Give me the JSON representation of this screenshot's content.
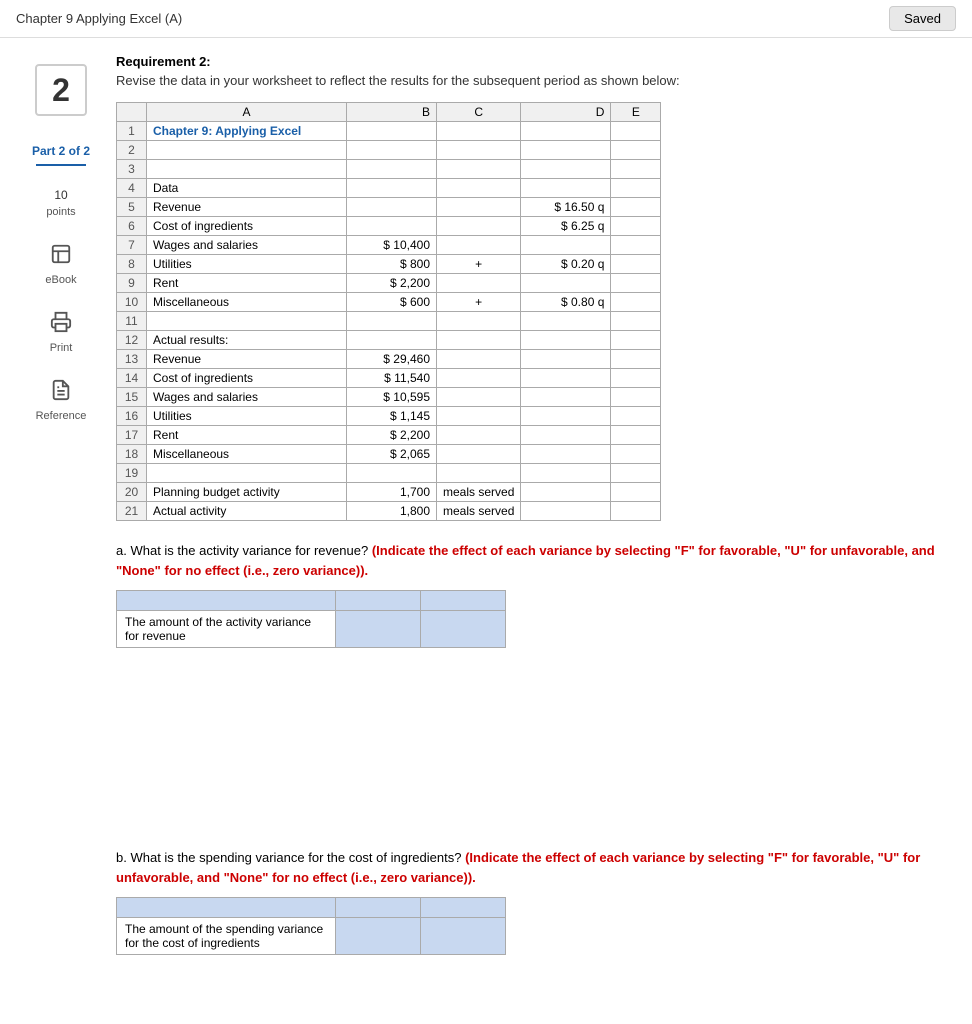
{
  "topBar": {
    "title": "Chapter 9 Applying Excel (A)",
    "savedLabel": "Saved"
  },
  "sidebar": {
    "stepNumber": "2",
    "partLabel": "Part 2 of 2",
    "points": "10",
    "pointsLabel": "points",
    "ebookLabel": "eBook",
    "printLabel": "Print",
    "referenceLabel": "Reference"
  },
  "requirement": {
    "title": "Requirement 2:",
    "text": "Revise the data in your worksheet to reflect the results for the subsequent period as shown below:"
  },
  "spreadsheet": {
    "headers": [
      "",
      "A",
      "B",
      "C",
      "D",
      "E"
    ],
    "rows": [
      {
        "num": "1",
        "a": "Chapter 9: Applying Excel",
        "b": "",
        "c": "",
        "d": "",
        "e": "",
        "aBlue": true
      },
      {
        "num": "2",
        "a": "",
        "b": "",
        "c": "",
        "d": "",
        "e": ""
      },
      {
        "num": "3",
        "a": "",
        "b": "",
        "c": "",
        "d": "",
        "e": ""
      },
      {
        "num": "4",
        "a": "Data",
        "b": "",
        "c": "",
        "d": "",
        "e": ""
      },
      {
        "num": "5",
        "a": "Revenue",
        "b": "",
        "c": "",
        "d": "$ 16.50 q",
        "e": ""
      },
      {
        "num": "6",
        "a": "Cost of ingredients",
        "b": "",
        "c": "",
        "d": "$ 6.25 q",
        "e": ""
      },
      {
        "num": "7",
        "a": "Wages and salaries",
        "b": "$ 10,400",
        "c": "",
        "d": "",
        "e": ""
      },
      {
        "num": "8",
        "a": "Utilities",
        "b": "$     800",
        "c": "+",
        "d": "$ 0.20 q",
        "e": ""
      },
      {
        "num": "9",
        "a": "Rent",
        "b": "$  2,200",
        "c": "",
        "d": "",
        "e": ""
      },
      {
        "num": "10",
        "a": "Miscellaneous",
        "b": "$     600",
        "c": "+",
        "d": "$ 0.80 q",
        "e": ""
      },
      {
        "num": "11",
        "a": "",
        "b": "",
        "c": "",
        "d": "",
        "e": ""
      },
      {
        "num": "12",
        "a": "Actual results:",
        "b": "",
        "c": "",
        "d": "",
        "e": ""
      },
      {
        "num": "13",
        "a": "Revenue",
        "b": "$ 29,460",
        "c": "",
        "d": "",
        "e": ""
      },
      {
        "num": "14",
        "a": "Cost of ingredients",
        "b": "$ 11,540",
        "c": "",
        "d": "",
        "e": ""
      },
      {
        "num": "15",
        "a": "Wages and salaries",
        "b": "$ 10,595",
        "c": "",
        "d": "",
        "e": ""
      },
      {
        "num": "16",
        "a": "Utilities",
        "b": "$  1,145",
        "c": "",
        "d": "",
        "e": ""
      },
      {
        "num": "17",
        "a": "Rent",
        "b": "$  2,200",
        "c": "",
        "d": "",
        "e": ""
      },
      {
        "num": "18",
        "a": "Miscellaneous",
        "b": "$  2,065",
        "c": "",
        "d": "",
        "e": ""
      },
      {
        "num": "19",
        "a": "",
        "b": "",
        "c": "",
        "d": "",
        "e": ""
      },
      {
        "num": "20",
        "a": "Planning budget activity",
        "b": "1,700",
        "c": "meals served",
        "d": "",
        "e": ""
      },
      {
        "num": "21",
        "a": "Actual activity",
        "b": "1,800",
        "c": "meals served",
        "d": "",
        "e": ""
      }
    ]
  },
  "questionA": {
    "label": "a.",
    "text": "What is the activity variance for revenue?",
    "highlightText": "(Indicate the effect of each variance by selecting \"F\" for favorable, \"U\" for unfavorable, and \"None\" for no effect (i.e., zero variance)).",
    "answerLabel": "The amount of the activity variance for revenue"
  },
  "questionB": {
    "label": "b.",
    "text": "What is the spending variance for the cost of ingredients?",
    "highlightText": "(Indicate the effect of each variance by selecting \"F\" for favorable, \"U\" for unfavorable, and \"None\" for no effect (i.e., zero variance)).",
    "answerLabel": "The amount of the spending variance for the cost of ingredients"
  }
}
